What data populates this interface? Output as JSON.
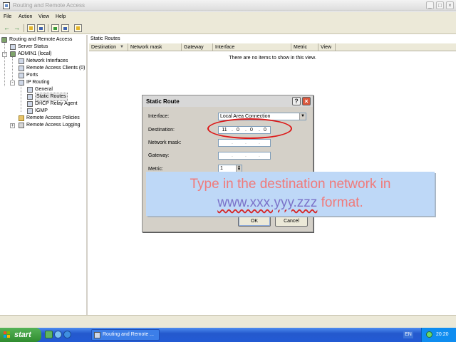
{
  "window": {
    "title": "Routing and Remote Access",
    "minimize": "_",
    "maximize": "□",
    "close": "×"
  },
  "menu": {
    "file": "File",
    "action": "Action",
    "view": "View",
    "help": "Help"
  },
  "tree": {
    "root": "Routing and Remote Access",
    "server_status": "Server Status",
    "server": "ADMIN1 (local)",
    "network_interfaces": "Network Interfaces",
    "remote_access_clients": "Remote Access Clients (0)",
    "ports": "Ports",
    "ip_routing": "IP Routing",
    "general": "General",
    "static_routes": "Static Routes",
    "dhcp_relay_agent": "DHCP Relay Agent",
    "igmp": "IGMP",
    "remote_access_policies": "Remote Access Policies",
    "remote_access_logging": "Remote Access Logging"
  },
  "content": {
    "pane_title": "Static Routes",
    "columns": [
      "Destination",
      "Network mask",
      "Gateway",
      "Interface",
      "Metric",
      "View"
    ],
    "empty_message": "There are no items to show in this view."
  },
  "dialog": {
    "title": "Static Route",
    "help": "?",
    "close": "×",
    "interface_label": "Interface:",
    "interface_value": "Local Area Connection",
    "destination_label": "Destination:",
    "destination_octets": [
      "11",
      "0",
      "0",
      "0"
    ],
    "netmask_label": "Network mask:",
    "gateway_label": "Gateway:",
    "metric_label": "Metric:",
    "metric_value": "1",
    "ok": "OK",
    "cancel": "Cancel"
  },
  "caption": {
    "line1": "Type in the destination network in",
    "format": "www.xxx.yyy.zzz",
    "line2_suffix": "format."
  },
  "taskbar": {
    "start": "start",
    "task": "Routing and Remote ...",
    "language": "EN",
    "clock": "20:20"
  },
  "colors": {
    "caption_text": "#f07a7a",
    "caption_background": "#bed8f7",
    "highlight_ellipse": "#dc1818",
    "taskbar": "#2459cd",
    "start_button": "#2f8c2f"
  }
}
